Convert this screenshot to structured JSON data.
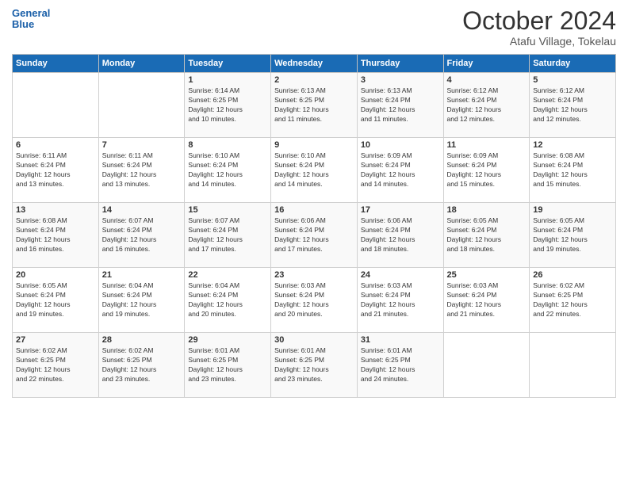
{
  "header": {
    "logo_line1": "General",
    "logo_line2": "Blue",
    "month": "October 2024",
    "location": "Atafu Village, Tokelau"
  },
  "days_of_week": [
    "Sunday",
    "Monday",
    "Tuesday",
    "Wednesday",
    "Thursday",
    "Friday",
    "Saturday"
  ],
  "weeks": [
    [
      {
        "day": "",
        "info": ""
      },
      {
        "day": "",
        "info": ""
      },
      {
        "day": "1",
        "info": "Sunrise: 6:14 AM\nSunset: 6:25 PM\nDaylight: 12 hours\nand 10 minutes."
      },
      {
        "day": "2",
        "info": "Sunrise: 6:13 AM\nSunset: 6:25 PM\nDaylight: 12 hours\nand 11 minutes."
      },
      {
        "day": "3",
        "info": "Sunrise: 6:13 AM\nSunset: 6:24 PM\nDaylight: 12 hours\nand 11 minutes."
      },
      {
        "day": "4",
        "info": "Sunrise: 6:12 AM\nSunset: 6:24 PM\nDaylight: 12 hours\nand 12 minutes."
      },
      {
        "day": "5",
        "info": "Sunrise: 6:12 AM\nSunset: 6:24 PM\nDaylight: 12 hours\nand 12 minutes."
      }
    ],
    [
      {
        "day": "6",
        "info": "Sunrise: 6:11 AM\nSunset: 6:24 PM\nDaylight: 12 hours\nand 13 minutes."
      },
      {
        "day": "7",
        "info": "Sunrise: 6:11 AM\nSunset: 6:24 PM\nDaylight: 12 hours\nand 13 minutes."
      },
      {
        "day": "8",
        "info": "Sunrise: 6:10 AM\nSunset: 6:24 PM\nDaylight: 12 hours\nand 14 minutes."
      },
      {
        "day": "9",
        "info": "Sunrise: 6:10 AM\nSunset: 6:24 PM\nDaylight: 12 hours\nand 14 minutes."
      },
      {
        "day": "10",
        "info": "Sunrise: 6:09 AM\nSunset: 6:24 PM\nDaylight: 12 hours\nand 14 minutes."
      },
      {
        "day": "11",
        "info": "Sunrise: 6:09 AM\nSunset: 6:24 PM\nDaylight: 12 hours\nand 15 minutes."
      },
      {
        "day": "12",
        "info": "Sunrise: 6:08 AM\nSunset: 6:24 PM\nDaylight: 12 hours\nand 15 minutes."
      }
    ],
    [
      {
        "day": "13",
        "info": "Sunrise: 6:08 AM\nSunset: 6:24 PM\nDaylight: 12 hours\nand 16 minutes."
      },
      {
        "day": "14",
        "info": "Sunrise: 6:07 AM\nSunset: 6:24 PM\nDaylight: 12 hours\nand 16 minutes."
      },
      {
        "day": "15",
        "info": "Sunrise: 6:07 AM\nSunset: 6:24 PM\nDaylight: 12 hours\nand 17 minutes."
      },
      {
        "day": "16",
        "info": "Sunrise: 6:06 AM\nSunset: 6:24 PM\nDaylight: 12 hours\nand 17 minutes."
      },
      {
        "day": "17",
        "info": "Sunrise: 6:06 AM\nSunset: 6:24 PM\nDaylight: 12 hours\nand 18 minutes."
      },
      {
        "day": "18",
        "info": "Sunrise: 6:05 AM\nSunset: 6:24 PM\nDaylight: 12 hours\nand 18 minutes."
      },
      {
        "day": "19",
        "info": "Sunrise: 6:05 AM\nSunset: 6:24 PM\nDaylight: 12 hours\nand 19 minutes."
      }
    ],
    [
      {
        "day": "20",
        "info": "Sunrise: 6:05 AM\nSunset: 6:24 PM\nDaylight: 12 hours\nand 19 minutes."
      },
      {
        "day": "21",
        "info": "Sunrise: 6:04 AM\nSunset: 6:24 PM\nDaylight: 12 hours\nand 19 minutes."
      },
      {
        "day": "22",
        "info": "Sunrise: 6:04 AM\nSunset: 6:24 PM\nDaylight: 12 hours\nand 20 minutes."
      },
      {
        "day": "23",
        "info": "Sunrise: 6:03 AM\nSunset: 6:24 PM\nDaylight: 12 hours\nand 20 minutes."
      },
      {
        "day": "24",
        "info": "Sunrise: 6:03 AM\nSunset: 6:24 PM\nDaylight: 12 hours\nand 21 minutes."
      },
      {
        "day": "25",
        "info": "Sunrise: 6:03 AM\nSunset: 6:24 PM\nDaylight: 12 hours\nand 21 minutes."
      },
      {
        "day": "26",
        "info": "Sunrise: 6:02 AM\nSunset: 6:25 PM\nDaylight: 12 hours\nand 22 minutes."
      }
    ],
    [
      {
        "day": "27",
        "info": "Sunrise: 6:02 AM\nSunset: 6:25 PM\nDaylight: 12 hours\nand 22 minutes."
      },
      {
        "day": "28",
        "info": "Sunrise: 6:02 AM\nSunset: 6:25 PM\nDaylight: 12 hours\nand 23 minutes."
      },
      {
        "day": "29",
        "info": "Sunrise: 6:01 AM\nSunset: 6:25 PM\nDaylight: 12 hours\nand 23 minutes."
      },
      {
        "day": "30",
        "info": "Sunrise: 6:01 AM\nSunset: 6:25 PM\nDaylight: 12 hours\nand 23 minutes."
      },
      {
        "day": "31",
        "info": "Sunrise: 6:01 AM\nSunset: 6:25 PM\nDaylight: 12 hours\nand 24 minutes."
      },
      {
        "day": "",
        "info": ""
      },
      {
        "day": "",
        "info": ""
      }
    ]
  ]
}
